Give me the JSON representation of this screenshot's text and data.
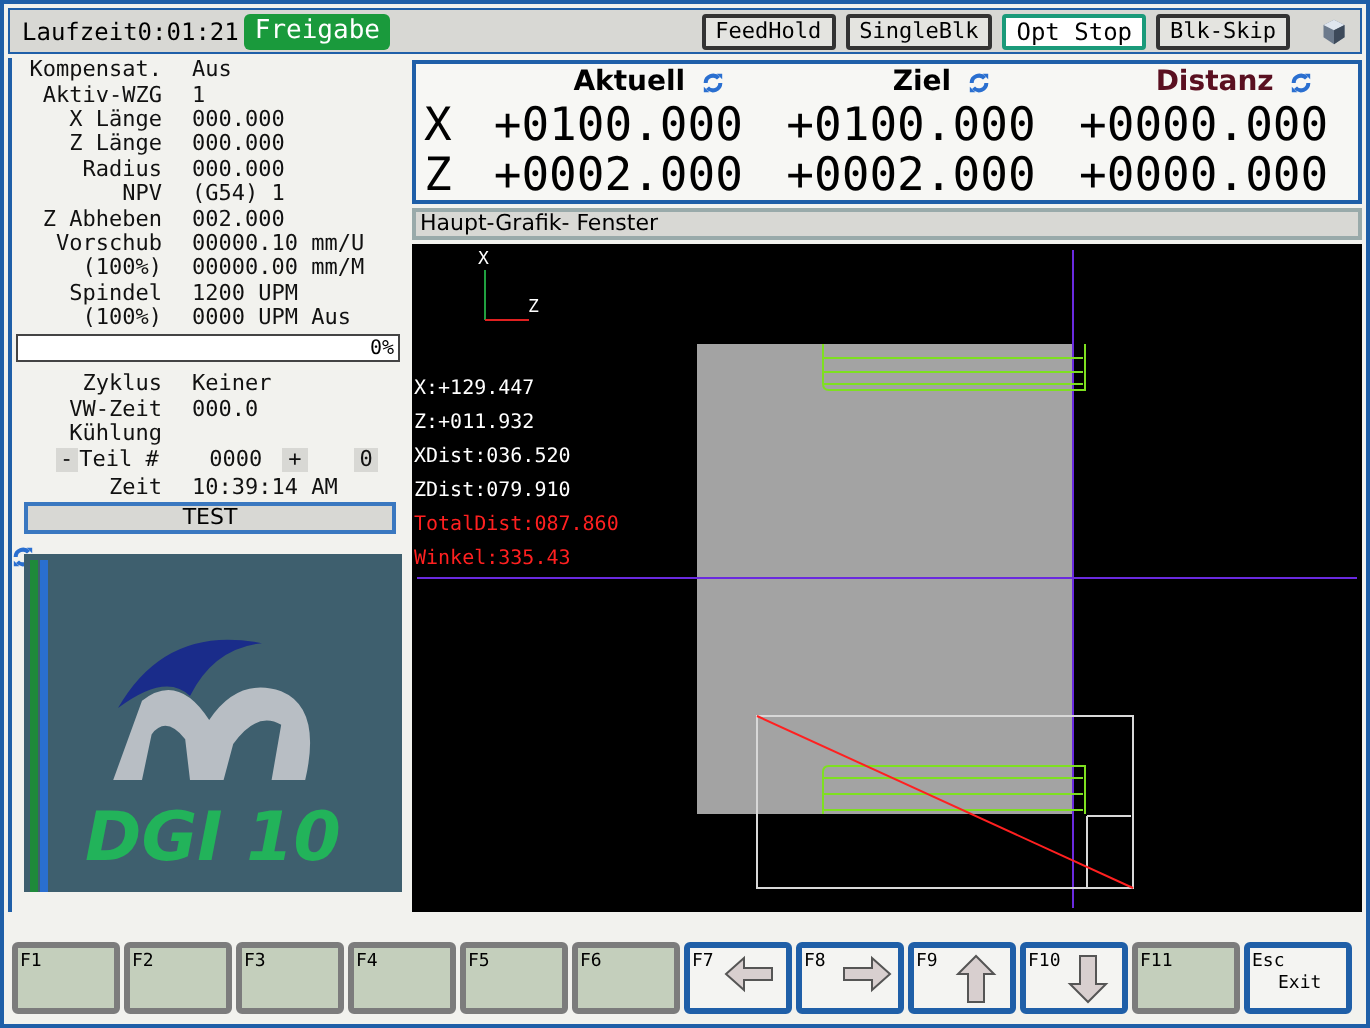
{
  "top_bar": {
    "runtime": "Laufzeit0:01:21",
    "status": "Freigabe",
    "toggles": [
      {
        "label": "FeedHold",
        "on": false
      },
      {
        "label": "SingleBlk",
        "on": false
      },
      {
        "label": "Opt Stop",
        "on": true
      },
      {
        "label": "Blk-Skip",
        "on": false
      }
    ]
  },
  "info_rows": [
    {
      "label": "Kompensat.",
      "value": "Aus"
    },
    {
      "label": "Aktiv-WZG",
      "value": "1"
    },
    {
      "label": "X Länge",
      "value": "000.000"
    },
    {
      "label": "Z Länge",
      "value": "000.000"
    },
    {
      "label": "Radius",
      "value": "000.000"
    },
    {
      "label": "NPV",
      "value": "(G54) 1"
    },
    {
      "label": "Z Abheben",
      "value": "002.000"
    },
    {
      "label": "Vorschub",
      "value": "00000.10 mm/U"
    },
    {
      "label": "(100%)",
      "value": "00000.00 mm/M"
    },
    {
      "label": "Spindel",
      "value": "1200 UPM"
    },
    {
      "label": "(100%)",
      "value": "0000 UPM Aus"
    }
  ],
  "progress": {
    "level": 0,
    "reading": "0%"
  },
  "cycle_rows": [
    {
      "label": "Zyklus",
      "value": "Keiner"
    },
    {
      "label": "VW-Zeit",
      "value": "000.0"
    },
    {
      "label": "Kühlung",
      "value": ""
    }
  ],
  "part_counter": {
    "minus": "-",
    "label": "Teil #",
    "value": "0000",
    "plus": "+",
    "count": "0"
  },
  "time_row": {
    "label": "Zeit",
    "value": "10:39:14 AM"
  },
  "mode_button": "TEST",
  "logo_text": "DGI 10",
  "dro": {
    "columns": [
      "Aktuell",
      "Ziel",
      "Distanz"
    ],
    "rows": [
      {
        "axis": "X",
        "values": [
          "+0100.000",
          "+0100.000",
          "+0000.000"
        ]
      },
      {
        "axis": "Z",
        "values": [
          "+0002.000",
          "+0002.000",
          "+0000.000"
        ]
      }
    ]
  },
  "graphic": {
    "title": "Haupt-Grafik- Fenster",
    "axis_x": "X",
    "axis_z": "Z",
    "readouts": [
      {
        "text": "X:+129.447",
        "kind": "normal"
      },
      {
        "text": "Z:+011.932",
        "kind": "normal"
      },
      {
        "text": "XDist:036.520",
        "kind": "normal"
      },
      {
        "text": "ZDist:079.910",
        "kind": "normal"
      },
      {
        "text": "TotalDist:087.860",
        "kind": "alert"
      },
      {
        "text": "Winkel:335.43",
        "kind": "alert"
      }
    ]
  },
  "function_keys": [
    {
      "label": "F1",
      "enabled": false,
      "kind": "plain"
    },
    {
      "label": "F2",
      "enabled": false,
      "kind": "plain"
    },
    {
      "label": "F3",
      "enabled": false,
      "kind": "plain"
    },
    {
      "label": "F4",
      "enabled": false,
      "kind": "plain"
    },
    {
      "label": "F5",
      "enabled": false,
      "kind": "plain"
    },
    {
      "label": "F6",
      "enabled": false,
      "kind": "plain"
    },
    {
      "label": "F7",
      "enabled": true,
      "kind": "left"
    },
    {
      "label": "F8",
      "enabled": true,
      "kind": "right"
    },
    {
      "label": "F9",
      "enabled": true,
      "kind": "up"
    },
    {
      "label": "F10",
      "enabled": true,
      "kind": "down"
    },
    {
      "label": "F11",
      "enabled": false,
      "kind": "plain"
    },
    {
      "label": "Esc",
      "enabled": true,
      "kind": "exit",
      "sublabel": "Exit"
    }
  ]
}
